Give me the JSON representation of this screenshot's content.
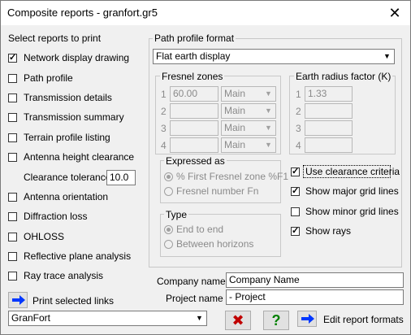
{
  "window": {
    "title": "Composite reports - granfort.gr5",
    "close_glyph": "✕"
  },
  "reports": {
    "heading": "Select reports to print",
    "items": [
      {
        "label": "Network display drawing",
        "checked": true
      },
      {
        "label": "Path profile",
        "checked": false
      },
      {
        "label": "Transmission details",
        "checked": false
      },
      {
        "label": "Transmission summary",
        "checked": false
      },
      {
        "label": "Terrain profile listing",
        "checked": false
      },
      {
        "label": "Antenna height clearance",
        "checked": false
      }
    ],
    "clearance_tolerance": {
      "label": "Clearance tolerance",
      "value": "10.0"
    },
    "items2": [
      {
        "label": "Antenna orientation",
        "checked": false
      },
      {
        "label": "Diffraction loss",
        "checked": false
      },
      {
        "label": "OHLOSS",
        "checked": false
      },
      {
        "label": "Reflective plane analysis",
        "checked": false
      },
      {
        "label": "Ray trace analysis",
        "checked": false
      }
    ]
  },
  "path_profile": {
    "group_label": "Path profile format",
    "format_value": "Flat earth display",
    "fresnel": {
      "label": "Fresnel zones",
      "rows": [
        {
          "num": "1",
          "value": "60.00",
          "type": "Main"
        },
        {
          "num": "2",
          "value": "",
          "type": "Main"
        },
        {
          "num": "3",
          "value": "",
          "type": "Main"
        },
        {
          "num": "4",
          "value": "",
          "type": "Main"
        }
      ]
    },
    "earth": {
      "label": "Earth radius factor (K)",
      "rows": [
        {
          "num": "1",
          "value": "1.33"
        },
        {
          "num": "2",
          "value": ""
        },
        {
          "num": "3",
          "value": ""
        },
        {
          "num": "4",
          "value": ""
        }
      ]
    },
    "expressed": {
      "label": "Expressed as",
      "options": [
        {
          "label": "% First Fresnel zone %F1",
          "selected": true
        },
        {
          "label": "Fresnel number Fn",
          "selected": false
        }
      ]
    },
    "type": {
      "label": "Type",
      "options": [
        {
          "label": "End to end",
          "selected": true
        },
        {
          "label": "Between horizons",
          "selected": false
        }
      ]
    },
    "options": [
      {
        "label": "Use clearance criteria",
        "checked": true
      },
      {
        "label": "Show major grid lines",
        "checked": true
      },
      {
        "label": "Show minor grid lines",
        "checked": false
      },
      {
        "label": "Show rays",
        "checked": true
      }
    ]
  },
  "company": {
    "label": "Company name",
    "value": "Company Name"
  },
  "project": {
    "label": "Project name",
    "value": "- Project"
  },
  "print_links": {
    "label": "Print selected links"
  },
  "template_select": {
    "value": "GranFort"
  },
  "buttons": {
    "cancel_glyph": "✖",
    "help_glyph": "?",
    "edit_formats_label": "Edit report formats"
  },
  "colors": {
    "arrow_blue": "#0037ff",
    "cancel_red": "#c00000",
    "help_green": "#008000"
  }
}
